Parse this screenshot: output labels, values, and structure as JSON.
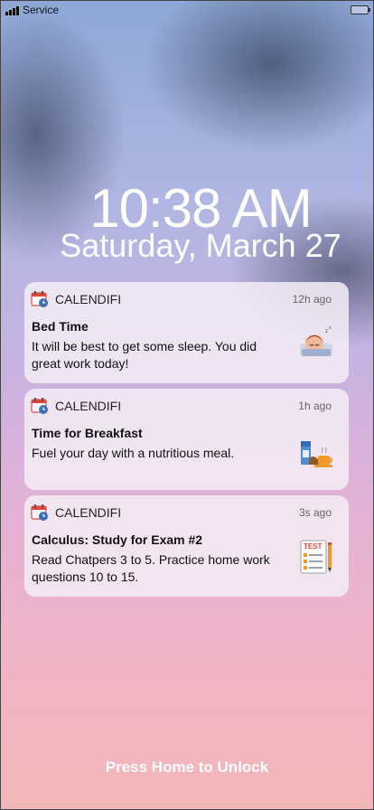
{
  "status_bar": {
    "carrier": "Service"
  },
  "lock_screen": {
    "time": "10:38 AM",
    "date": "Saturday, March 27",
    "unlock_hint": "Press Home to Unlock"
  },
  "notifications": [
    {
      "app": "CALENDIFI",
      "time": "12h ago",
      "title": "Bed Time",
      "body": "It will be best to get some sleep.  You did great work today!",
      "icon": "sleeping-face-icon"
    },
    {
      "app": "CALENDIFI",
      "time": "1h ago",
      "title": "Time for Breakfast",
      "body": "Fuel your day with a nutritious meal.",
      "icon": "breakfast-icon"
    },
    {
      "app": "CALENDIFI",
      "time": "3s ago",
      "title": "Calculus: Study for Exam #2",
      "body": "Read Chatpers 3 to 5.  Practice home work questions 10 to 15.",
      "icon": "test-sheet-icon",
      "icon_text": "TEST"
    }
  ],
  "colors": {
    "calendar_red": "#e8463c",
    "calendar_blue": "#3b6fb6"
  }
}
